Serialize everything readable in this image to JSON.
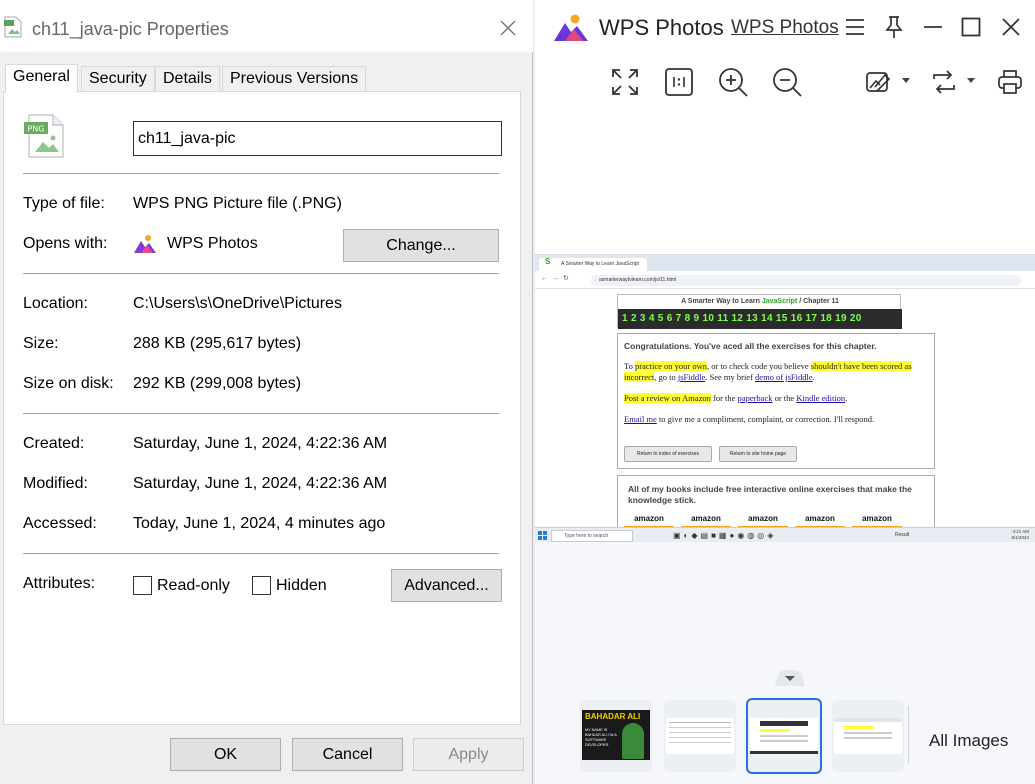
{
  "properties": {
    "title": "ch11_java-pic Properties",
    "tabs": [
      "General",
      "Security",
      "Details",
      "Previous Versions"
    ],
    "active_tab": "General",
    "icon_label": "PNG",
    "file_name": "ch11_java-pic",
    "type_label": "Type of file:",
    "type_value": "WPS PNG Picture file (.PNG)",
    "opens_label": "Opens with:",
    "opens_value": "WPS Photos",
    "change_button": "Change...",
    "location_label": "Location:",
    "location_value": "C:\\Users\\s\\OneDrive\\Pictures",
    "size_label": "Size:",
    "size_value": "288 KB (295,617 bytes)",
    "size_disk_label": "Size on disk:",
    "size_disk_value": "292 KB (299,008 bytes)",
    "created_label": "Created:",
    "created_value": "Saturday, June 1, 2024, 4:22:36 AM",
    "modified_label": "Modified:",
    "modified_value": "Saturday, June 1, 2024, 4:22:36 AM",
    "accessed_label": "Accessed:",
    "accessed_value": "Today, June 1, 2024, 4 minutes ago",
    "attributes_label": "Attributes:",
    "readonly_label": "Read-only",
    "hidden_label": "Hidden",
    "advanced_button": "Advanced...",
    "ok_button": "OK",
    "cancel_button": "Cancel",
    "apply_button": "Apply"
  },
  "wps": {
    "app_name": "WPS Photos",
    "app_link": "WPS Photos",
    "all_images": "All Images",
    "accent": "#2f6fdb",
    "thumb1_text": "BAHADAR ALI",
    "thumb1_sub": "MY NAME IS BAHDAR ALI I'M A SOFTWARE DEVELOPER."
  },
  "screenshot": {
    "tab_title": "A Smarter Way to Learn JavaScript",
    "url": "asmarterwaytolearn.com/js/11.html",
    "header_prefix": "A Smarter Way to Learn",
    "header_js": "JavaScript",
    "header_suffix": "/ Chapter 11",
    "numbers": "1 2 3 4 5 6 7 8 9 10 11 12 13 14 15 16 17 18 19 20",
    "congrats": "Congratulations. You've aced all the exercises for this chapter.",
    "p1_a": "To",
    "p1_hl1": "practice on your own",
    "p1_b": ", or to check code you believe",
    "p1_hl2": "shouldn't have been scored as incorrect",
    "p1_c": ", go to",
    "p1_link1": "jsFiddle",
    "p1_d": ". See my brief",
    "p1_link2": "demo of jsFiddle",
    "p1_e": ".",
    "p2_hl": "Post a review on Amazon",
    "p2_a": "for the",
    "p2_link1": "paperback",
    "p2_b": "or the",
    "p2_link2": "Kindle edition",
    "p2_c": ".",
    "p3_link": "Email me",
    "p3_text": "to give me a compliment, complaint, or correction. I'll respond.",
    "btn1": "Return to index of exercises",
    "btn2": "Return to site home page",
    "books_text": "All of my books include free interactive online exercises that make the knowledge stick.",
    "amazon": "amazon",
    "search_placeholder": "Type here to search",
    "weather": "Result",
    "time": "4:21 AM",
    "date": "6/1/2024"
  }
}
